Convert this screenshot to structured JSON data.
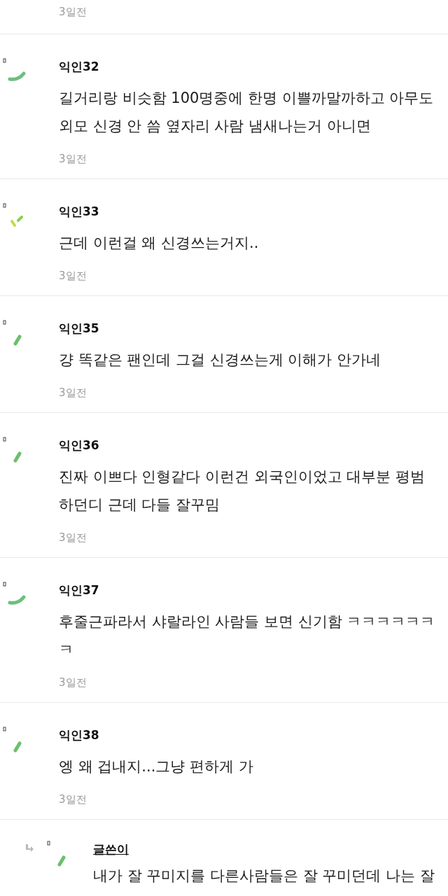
{
  "top_time": "3일전",
  "comments": [
    {
      "author": "익인32",
      "kind": "arc",
      "reply": false,
      "body": "길거리랑 비슷함 100명중에 한명 이쁠까말까하고 아무도 외모 신경 안 씀 옆자리 사람 냄새나는거 아니면",
      "time": "3일전"
    },
    {
      "author": "익인33",
      "kind": "dashes",
      "reply": false,
      "body": "근데 이런걸 왜 신경쓰는거지..",
      "time": "3일전"
    },
    {
      "author": "익인35",
      "kind": "stroke",
      "reply": false,
      "body": "걍 똑같은 팬인데 그걸 신경쓰는게 이해가 안가네",
      "time": "3일전"
    },
    {
      "author": "익인36",
      "kind": "stroke",
      "reply": false,
      "body": "진짜 이쁘다 인형같다 이런건 외국인이었고 대부분 평범하던디 근데 다들 잘꾸밈",
      "time": "3일전"
    },
    {
      "author": "익인37",
      "kind": "arc",
      "reply": false,
      "body": "후줄근파라서 샤랄라인 사람들 보면 신기함 ㅋㅋㅋㅋㅋㅋㅋ",
      "time": "3일전"
    },
    {
      "author": "익인38",
      "kind": "stroke",
      "reply": false,
      "body": "엥 왜 겁내지...그냥 편하게 가",
      "time": "3일전"
    },
    {
      "author": "글쓴이",
      "kind": "stroke",
      "reply": true,
      "body": "내가 잘 꾸미지를 다른사람들은 잘 꾸미던데 나는 잘"
    }
  ]
}
